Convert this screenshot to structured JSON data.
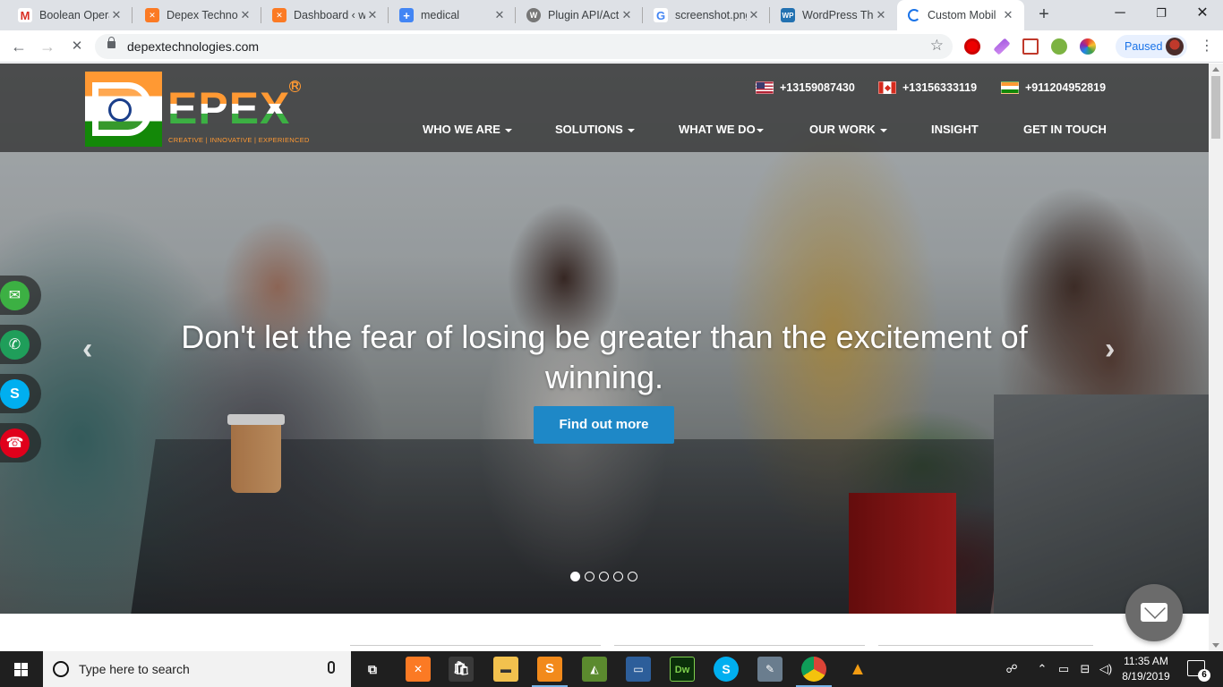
{
  "tabs": [
    {
      "title": "Boolean Opera",
      "icon": "gmail-icon",
      "color": "#ffffff"
    },
    {
      "title": "Depex Technol",
      "icon": "xampp-icon",
      "color": "#fb7a24"
    },
    {
      "title": "Dashboard ‹ w",
      "icon": "xampp-icon",
      "color": "#fb7a24"
    },
    {
      "title": "medical",
      "icon": "plus-icon",
      "color": "#4285f4"
    },
    {
      "title": "Plugin API/Act",
      "icon": "wordpress-icon",
      "color": "#777777"
    },
    {
      "title": "screenshot.png",
      "icon": "google-icon",
      "color": "#ffffff"
    },
    {
      "title": "WordPress The",
      "icon": "wp-icon",
      "color": "#2271b1"
    },
    {
      "title": "Custom Mobil",
      "icon": "loading-icon",
      "color": "#1a73e8"
    }
  ],
  "address_bar": {
    "url": "depextechnologies.com"
  },
  "profile": {
    "status": "Paused"
  },
  "site": {
    "logo_word": "EPEX",
    "logo_tagline": "CREATIVE | INNOVATIVE | EXPERIENCED",
    "phones": [
      {
        "country": "us",
        "number": "+13159087430"
      },
      {
        "country": "ca",
        "number": "+13156333119"
      },
      {
        "country": "in",
        "number": "+911204952819"
      }
    ],
    "nav": [
      {
        "label": "WHO WE ARE",
        "dropdown": true
      },
      {
        "label": "SOLUTIONS",
        "dropdown": true
      },
      {
        "label": "WHAT WE DO",
        "dropdown": true
      },
      {
        "label": "OUR WORK",
        "dropdown": true
      },
      {
        "label": "INSIGHT",
        "dropdown": false
      },
      {
        "label": "GET IN TOUCH",
        "dropdown": false
      }
    ],
    "hero": {
      "headline": "Don't let the fear of losing be greater than the excitement of winning.",
      "cta": "Find out more",
      "slide_count": 5,
      "active_slide": 1
    },
    "social": [
      {
        "name": "email",
        "color": "#3cb043"
      },
      {
        "name": "whatsapp",
        "color": "#1f9e5a"
      },
      {
        "name": "skype",
        "color": "#00aff0"
      },
      {
        "name": "phone",
        "color": "#e0001b"
      }
    ]
  },
  "taskbar": {
    "search_placeholder": "Type here to search",
    "time": "11:35 AM",
    "date": "8/19/2019",
    "notification_count": "6"
  }
}
